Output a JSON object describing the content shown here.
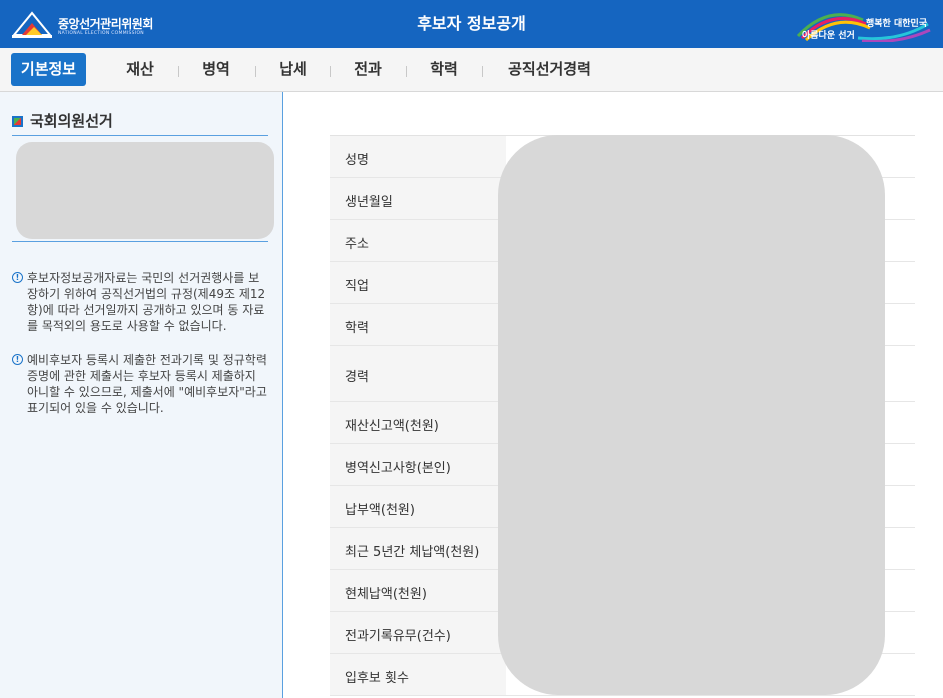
{
  "header": {
    "org_name_kr": "중앙선거관리위원회",
    "org_name_en": "NATIONAL ELECTION COMMISSION",
    "title": "후보자 정보공개",
    "slogan_top": "행복한 대한민국",
    "slogan_bottom": "아름다운 선거"
  },
  "tabs": [
    "기본정보",
    "재산",
    "병역",
    "납세",
    "전과",
    "학력",
    "공직선거경력"
  ],
  "active_tab": "기본정보",
  "sidebar": {
    "election_type": "국회의원선거",
    "notices": [
      "후보자정보공개자료는 국민의 선거권행사를 보장하기 위하여 공직선거법의 규정(제49조 제12항)에 따라 선거일까지 공개하고 있으며 동 자료를 목적외의 용도로 사용할 수 없습니다.",
      "예비후보자 등록시 제출한 전과기록 및 정규학력 증명에 관한 제출서는 후보자 등록시 제출하지 아니할 수 있으므로, 제출서에 \"예비후보자\"라고 표기되어 있을 수 있습니다."
    ]
  },
  "fields": [
    {
      "label": "성명",
      "value": ""
    },
    {
      "label": "생년월일",
      "value": ""
    },
    {
      "label": "주소",
      "value": ""
    },
    {
      "label": "직업",
      "value": ""
    },
    {
      "label": "학력",
      "value": ""
    },
    {
      "label": "경력",
      "value": ""
    },
    {
      "label": "재산신고액(천원)",
      "value": ""
    },
    {
      "label": "병역신고사항(본인)",
      "value": ""
    },
    {
      "label": "납부액(천원)",
      "value": ""
    },
    {
      "label": "최근 5년간 체납액(천원)",
      "value": ""
    },
    {
      "label": "현체납액(천원)",
      "value": ""
    },
    {
      "label": "전과기록유무(건수)",
      "value": ""
    },
    {
      "label": "입후보 횟수",
      "value": ""
    }
  ],
  "colors": {
    "header_bg": "#1565c0",
    "active_tab_bg": "#1a73c9",
    "sidebar_bg": "#f1f6fb",
    "accent_line": "#5aa0e0",
    "redaction": "#d8d8d8"
  }
}
